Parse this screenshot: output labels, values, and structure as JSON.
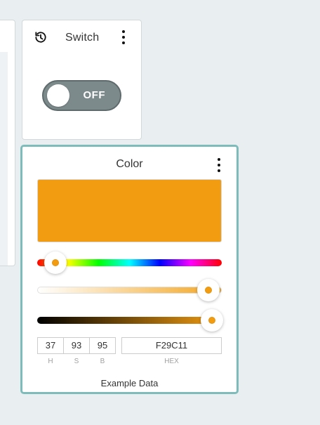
{
  "switch_widget": {
    "title": "Switch",
    "state_label": "OFF",
    "history_icon": "history-icon",
    "menu_icon": "more-vertical-icon"
  },
  "color_widget": {
    "title": "Color",
    "menu_icon": "more-vertical-icon",
    "color": "#F29C11",
    "accent_border": "#7EBCBC",
    "hue": "37",
    "saturation": "93",
    "brightness": "95",
    "hex": "F29C11",
    "labels": {
      "h": "H",
      "s": "S",
      "b": "B",
      "hex": "HEX"
    },
    "footer": "Example Data"
  },
  "colors": {
    "toggle_off": "#7D8A8C",
    "background": "#E9EEF0"
  }
}
